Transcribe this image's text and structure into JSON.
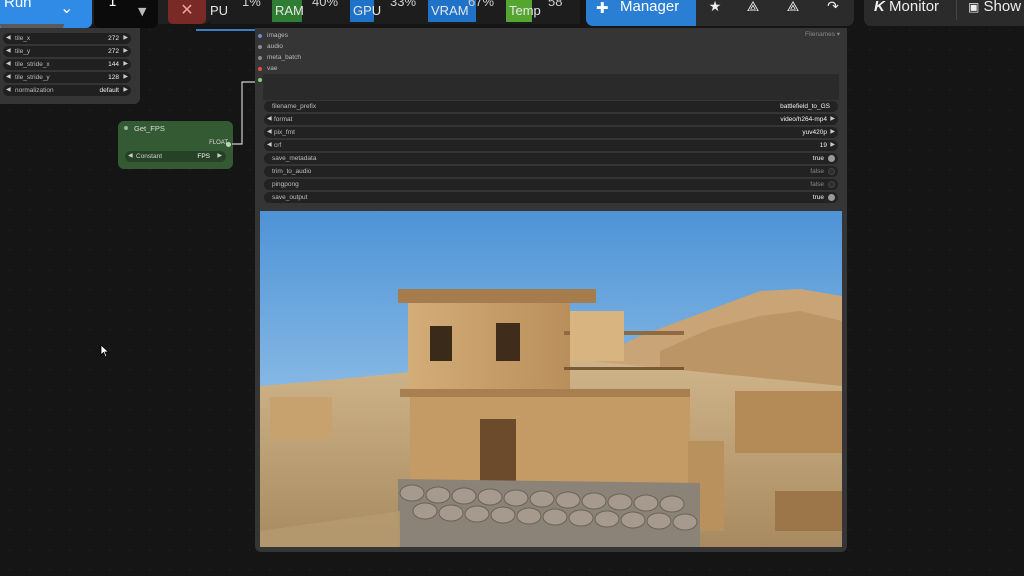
{
  "toolbar": {
    "run_label": "Run",
    "batch_count": "1",
    "cancel_label": "✕",
    "monitors": [
      {
        "name": "PU",
        "percent": "1%",
        "color": "#1e1e1e"
      },
      {
        "name": "RAM",
        "percent": "40%",
        "color": "#2e7d32"
      },
      {
        "name": "GPU",
        "percent": "33%",
        "color": "#1e73c9"
      },
      {
        "name": "VRAM",
        "percent": "67%",
        "color": "#1e73c9"
      },
      {
        "name": "Temp",
        "percent": "58",
        "color": "#55a630"
      }
    ],
    "manager_label": "Manager",
    "monitor_label": "Monitor",
    "show_label": "Show"
  },
  "tile_node": {
    "widgets": [
      {
        "label": "tile_x",
        "value": "272"
      },
      {
        "label": "tile_y",
        "value": "272"
      },
      {
        "label": "tile_stride_x",
        "value": "144"
      },
      {
        "label": "tile_stride_y",
        "value": "128"
      },
      {
        "label": "normalization",
        "value": "default"
      }
    ]
  },
  "fps_node": {
    "title": "Get_FPS",
    "output_type": "FLOAT",
    "widget_label": "Constant",
    "widget_value": "FPS"
  },
  "video_node": {
    "filenames_label": "Filenames ▾",
    "inputs": [
      {
        "label": "images",
        "dot": "#7b86c7"
      },
      {
        "label": "audio",
        "dot": "#8a8a8a"
      },
      {
        "label": "meta_batch",
        "dot": "#8a8a8a"
      },
      {
        "label": "vae",
        "dot": "#e05050"
      }
    ],
    "widgets": [
      {
        "label": "filename_prefix",
        "value": "battlefield_to_GS"
      },
      {
        "label": "format",
        "value": "video/h264-mp4"
      },
      {
        "label": "pix_fmt",
        "value": "yuv420p"
      },
      {
        "label": "crf",
        "value": "19"
      },
      {
        "label": "save_metadata",
        "value": "true"
      },
      {
        "label": "trim_to_audio",
        "value": "false"
      },
      {
        "label": "pingpong",
        "value": "false"
      },
      {
        "label": "save_output",
        "value": "true"
      }
    ]
  },
  "colors": {
    "accent": "#2f8be6",
    "node_bg": "#353535",
    "fps_node_bg": "#345a34"
  }
}
